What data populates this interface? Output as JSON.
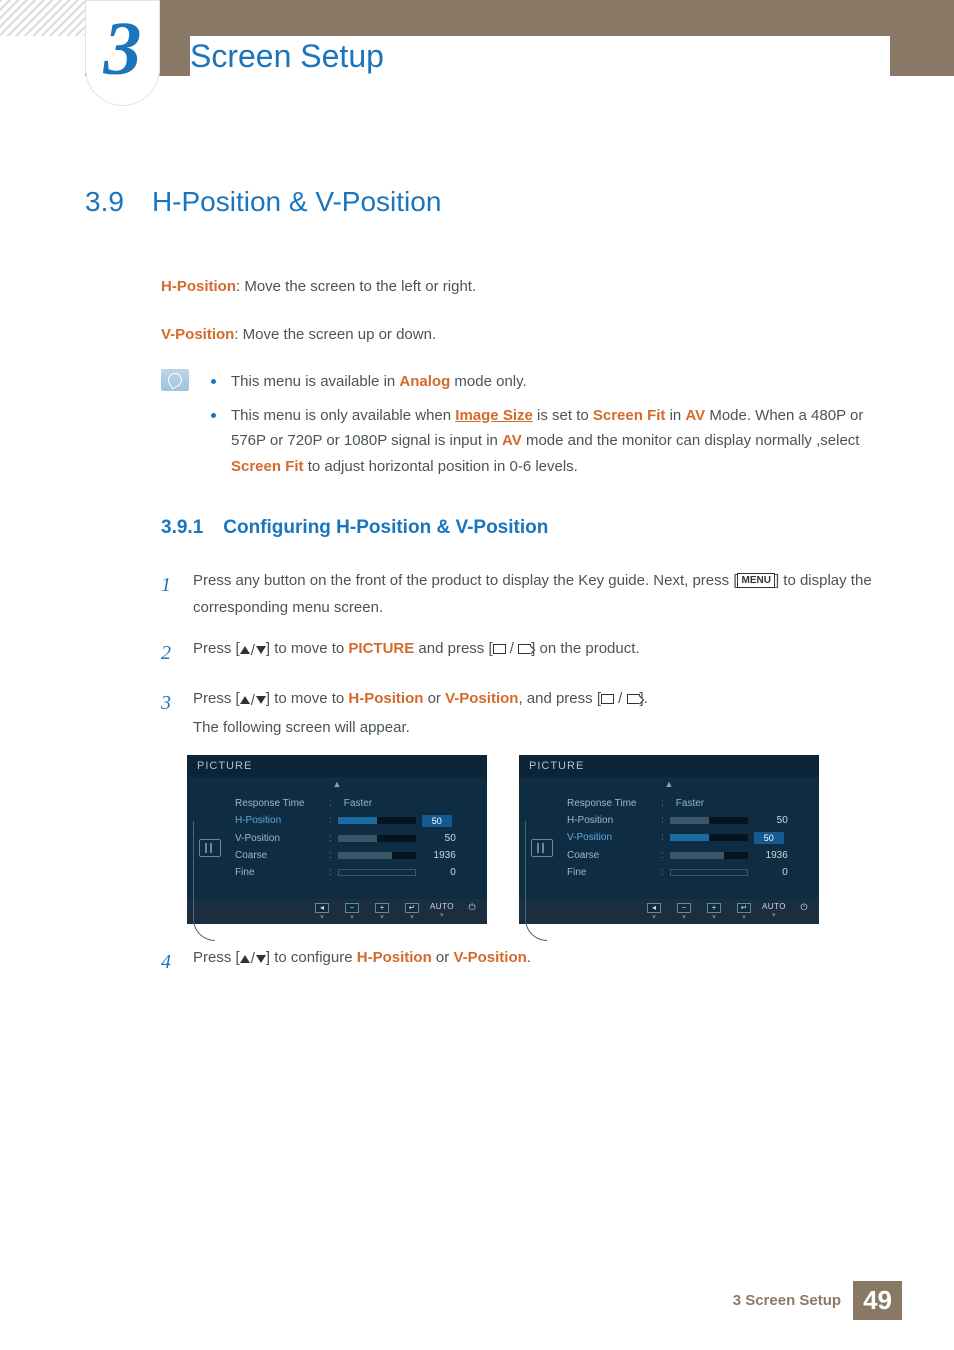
{
  "chapter": {
    "number": "3",
    "title": "Screen Setup"
  },
  "section": {
    "number": "3.9",
    "title": "H-Position & V-Position"
  },
  "intro": {
    "hpos_label": "H-Position",
    "hpos_text": ": Move the screen to the left or right.",
    "vpos_label": "V-Position",
    "vpos_text": ": Move the screen up or down."
  },
  "notes": {
    "item1_a": "This menu is available in ",
    "item1_b": "Analog",
    "item1_c": " mode only.",
    "item2_a": "This menu is only available when ",
    "item2_b": "Image Size",
    "item2_c": " is set to ",
    "item2_d": "Screen Fit",
    "item2_e": " in ",
    "item2_f": "AV",
    "item2_g": " Mode. When a 480P or 576P or 720P or 1080P signal is input in ",
    "item2_h": "AV",
    "item2_i": " mode and the monitor can display normally ,select ",
    "item2_j": "Screen Fit",
    "item2_k": " to adjust horizontal position in 0-6 levels."
  },
  "subsection": {
    "number": "3.9.1",
    "title": "Configuring H-Position & V-Position"
  },
  "steps": {
    "s1_a": "Press any button on the front of the product to display the Key guide. Next, press [",
    "s1_menu": "MENU",
    "s1_b": "] to display the corresponding menu screen.",
    "s2_a": "Press [",
    "s2_b": "] to move to ",
    "s2_c": "PICTURE",
    "s2_d": " and press [",
    "s2_e": "] on the product.",
    "s3_a": "Press [",
    "s3_b": "] to move to ",
    "s3_c": "H-Position",
    "s3_d": " or ",
    "s3_e": "V-Position",
    "s3_f": ", and press [",
    "s3_g": "].",
    "s3_tail": "The following screen will appear.",
    "s4_a": "Press [",
    "s4_b": "] to configure ",
    "s4_c": "H-Position",
    "s4_d": " or ",
    "s4_e": "V-Position",
    "s4_f": "."
  },
  "osd": {
    "title": "PICTURE",
    "rows": {
      "response": "Response Time",
      "response_val": "Faster",
      "hpos": "H-Position",
      "hpos_val": "50",
      "vpos": "V-Position",
      "vpos_val": "50",
      "coarse": "Coarse",
      "coarse_val": "1936",
      "fine": "Fine",
      "fine_val": "0"
    },
    "footer": {
      "auto": "AUTO"
    }
  },
  "chart_data": [
    {
      "type": "table",
      "title": "PICTURE (H-Position selected)",
      "rows": [
        {
          "label": "Response Time",
          "value": "Faster"
        },
        {
          "label": "H-Position",
          "value": 50,
          "selected": true
        },
        {
          "label": "V-Position",
          "value": 50
        },
        {
          "label": "Coarse",
          "value": 1936
        },
        {
          "label": "Fine",
          "value": 0
        }
      ]
    },
    {
      "type": "table",
      "title": "PICTURE (V-Position selected)",
      "rows": [
        {
          "label": "Response Time",
          "value": "Faster"
        },
        {
          "label": "H-Position",
          "value": 50
        },
        {
          "label": "V-Position",
          "value": 50,
          "selected": true
        },
        {
          "label": "Coarse",
          "value": 1936
        },
        {
          "label": "Fine",
          "value": 0
        }
      ]
    }
  ],
  "footer": {
    "text": "3 Screen Setup",
    "page": "49"
  }
}
